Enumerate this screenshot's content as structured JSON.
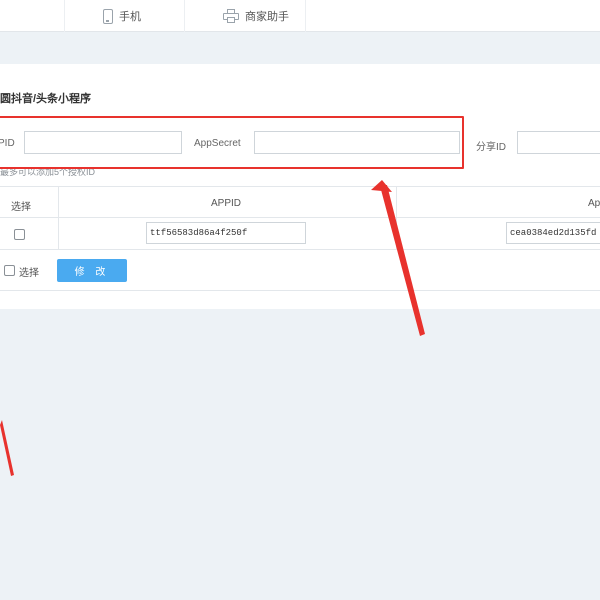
{
  "topnav": {
    "items": [
      {
        "label": "手机",
        "icon": "phone-icon"
      },
      {
        "label": "商家助手",
        "icon": "printer-icon"
      }
    ]
  },
  "panel": {
    "title": "圆抖音/头条小程序",
    "fields": {
      "appid_label": "PID",
      "appid_value": "",
      "secret_label": "AppSecret",
      "secret_value": "",
      "share_label": "分享ID",
      "share_value": ""
    },
    "hint": "最多可以添加5个授权ID"
  },
  "table": {
    "headers": [
      "选择",
      "APPID",
      "Ap"
    ],
    "rows": [
      {
        "checked": false,
        "appid": "ttf56583d86a4f250f",
        "secret": "cea0384ed2d135fd"
      }
    ],
    "select_all_label": "选择",
    "modify_button": "修 改"
  },
  "colors": {
    "accent": "#4aaaf0",
    "highlight": "#e8322d",
    "background": "#edf2f6"
  }
}
